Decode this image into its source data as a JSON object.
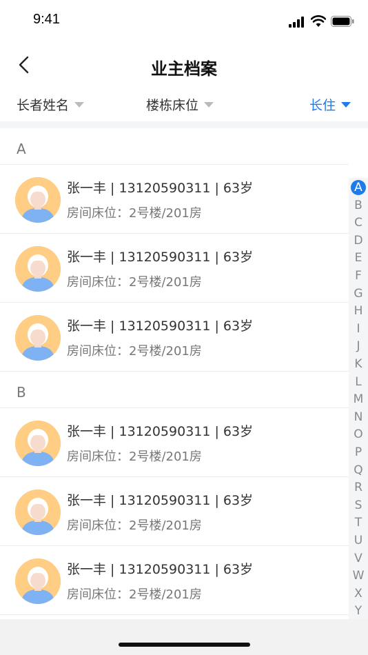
{
  "status_bar": {
    "time": "9:41"
  },
  "nav": {
    "title": "业主档案"
  },
  "filters": [
    {
      "label": "长者姓名",
      "active": false
    },
    {
      "label": "楼栋床位",
      "active": false
    },
    {
      "label": "长住",
      "active": true
    }
  ],
  "sections": [
    {
      "letter": "A",
      "items": [
        {
          "primary": "张一丰 | 13120590311 | 63岁",
          "secondary": "房间床位：2号楼/201房"
        },
        {
          "primary": "张一丰 | 13120590311 | 63岁",
          "secondary": "房间床位：2号楼/201房"
        },
        {
          "primary": "张一丰 | 13120590311 | 63岁",
          "secondary": "房间床位：2号楼/201房"
        }
      ]
    },
    {
      "letter": "B",
      "items": [
        {
          "primary": "张一丰 | 13120590311 | 63岁",
          "secondary": "房间床位：2号楼/201房"
        },
        {
          "primary": "张一丰 | 13120590311 | 63岁",
          "secondary": "房间床位：2号楼/201房"
        },
        {
          "primary": "张一丰 | 13120590311 | 63岁",
          "secondary": "房间床位：2号楼/201房"
        }
      ]
    }
  ],
  "index_letters": [
    "A",
    "B",
    "C",
    "D",
    "E",
    "F",
    "G",
    "H",
    "I",
    "J",
    "K",
    "L",
    "M",
    "N",
    "O",
    "P",
    "Q",
    "R",
    "S",
    "T",
    "U",
    "V",
    "W",
    "X",
    "Y"
  ],
  "index_active": "A",
  "colors": {
    "accent": "#1e7be8",
    "avatar_bg": "#ffcd83",
    "avatar_shirt": "#7fb2f2"
  }
}
